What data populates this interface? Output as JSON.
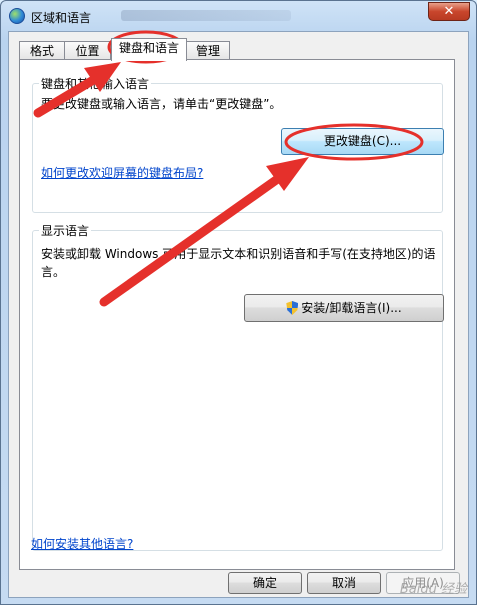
{
  "window": {
    "title": "区域和语言",
    "close_label": "✕"
  },
  "tabs": [
    {
      "label": "格式"
    },
    {
      "label": "位置"
    },
    {
      "label": "键盘和语言"
    },
    {
      "label": "管理"
    }
  ],
  "keyboard_group": {
    "title": "键盘和其他输入语言",
    "description": "要更改键盘或输入语言，请单击“更改键盘”。",
    "change_keyboard_button": "更改键盘(C)...",
    "welcome_layout_link": "如何更改欢迎屏幕的键盘布局?"
  },
  "display_group": {
    "title": "显示语言",
    "description_line1": "安装或卸载 Windows 可用于显示文本和识别语音和手写(在支持地区)的语",
    "description_line2": "言。",
    "install_button": "安装/卸载语言(I)..."
  },
  "footer": {
    "other_languages_link": "如何安装其他语言?",
    "ok_button": "确定",
    "cancel_button": "取消",
    "apply_button": "应用(A)"
  },
  "watermark": "Baidu 经验",
  "colors": {
    "annotation": "#e5302b",
    "link": "#0044cc"
  }
}
